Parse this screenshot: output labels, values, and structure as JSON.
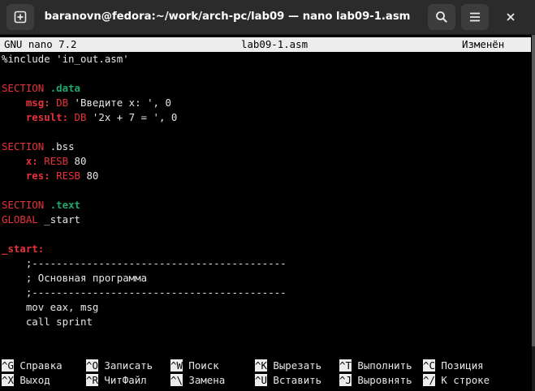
{
  "window": {
    "title": "baranovn@fedora:~/work/arch-pc/lab09 — nano lab09-1.asm",
    "new_tab_icon": "plus-square-icon",
    "search_icon": "search-icon",
    "menu_icon": "hamburger-menu-icon",
    "close_icon": "close-icon"
  },
  "nano": {
    "version": "GNU nano 7.2",
    "filename": "lab09-1.asm",
    "status": "Изменён"
  },
  "code": {
    "include": "%include 'in_out.asm'",
    "l1_kw": "SECTION",
    "l1_name": ".data",
    "l2_label": "msg:",
    "l2_dir": "DB",
    "l2_rest": "'Введите x: ', 0",
    "l3_label": "result:",
    "l3_dir": "DB",
    "l3_rest": "'2x + 7 = ', 0",
    "l4_kw": "SECTION",
    "l4_name": ".bss",
    "l5_label": "x:",
    "l5_dir": "RESB",
    "l5_rest": "80",
    "l6_label": "res:",
    "l6_dir": "RESB",
    "l6_rest": "80",
    "l7_kw": "SECTION",
    "l7_name": ".text",
    "l8_kw": "GLOBAL",
    "l8_rest": "_start",
    "l9_label": "_start:",
    "l10": ";------------------------------------------",
    "l11": "; Основная программа",
    "l12": ";------------------------------------------",
    "l13": "mov eax, msg",
    "l14": "call sprint"
  },
  "help": {
    "row1": [
      {
        "key": "^G",
        "label": "Справка"
      },
      {
        "key": "^O",
        "label": "Записать"
      },
      {
        "key": "^W",
        "label": "Поиск"
      },
      {
        "key": "^K",
        "label": "Вырезать"
      },
      {
        "key": "^T",
        "label": "Выполнить"
      },
      {
        "key": "^C",
        "label": "Позиция"
      }
    ],
    "row2": [
      {
        "key": "^X",
        "label": "Выход"
      },
      {
        "key": "^R",
        "label": "ЧитФайл"
      },
      {
        "key": "^\\",
        "label": "Замена"
      },
      {
        "key": "^U",
        "label": "Вставить"
      },
      {
        "key": "^J",
        "label": "Выровнять"
      },
      {
        "key": "^/",
        "label": "К строке"
      }
    ]
  }
}
